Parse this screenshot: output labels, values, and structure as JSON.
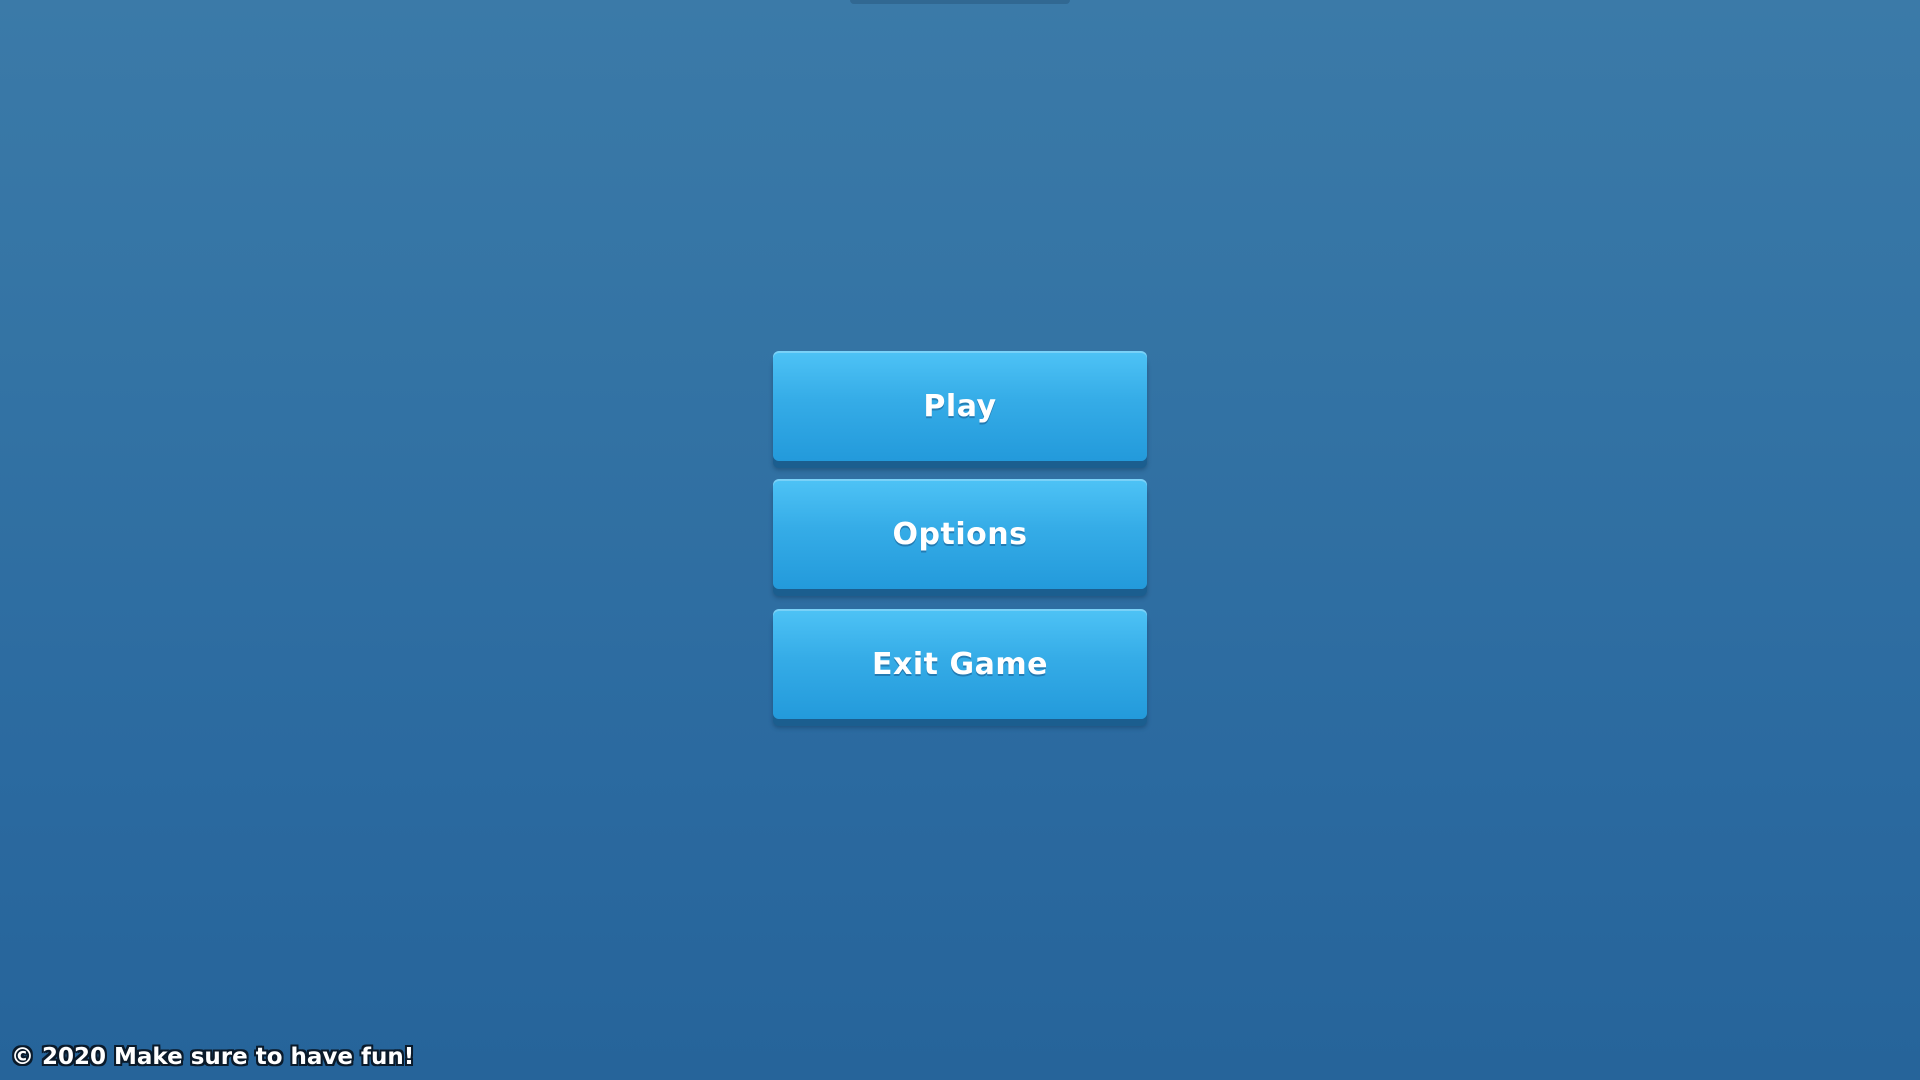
{
  "menu": {
    "buttons": [
      {
        "label": "Play"
      },
      {
        "label": "Options"
      },
      {
        "label": "Exit Game"
      }
    ]
  },
  "footer": {
    "copyright": "© 2020 Make sure to have fun!"
  },
  "colors": {
    "background_top": "#3b7aa8",
    "background_bottom": "#26649a",
    "button_top": "#4ec3f6",
    "button_bottom": "#239adb",
    "button_shadow": "#1b5e8f",
    "text": "#ffffff"
  }
}
